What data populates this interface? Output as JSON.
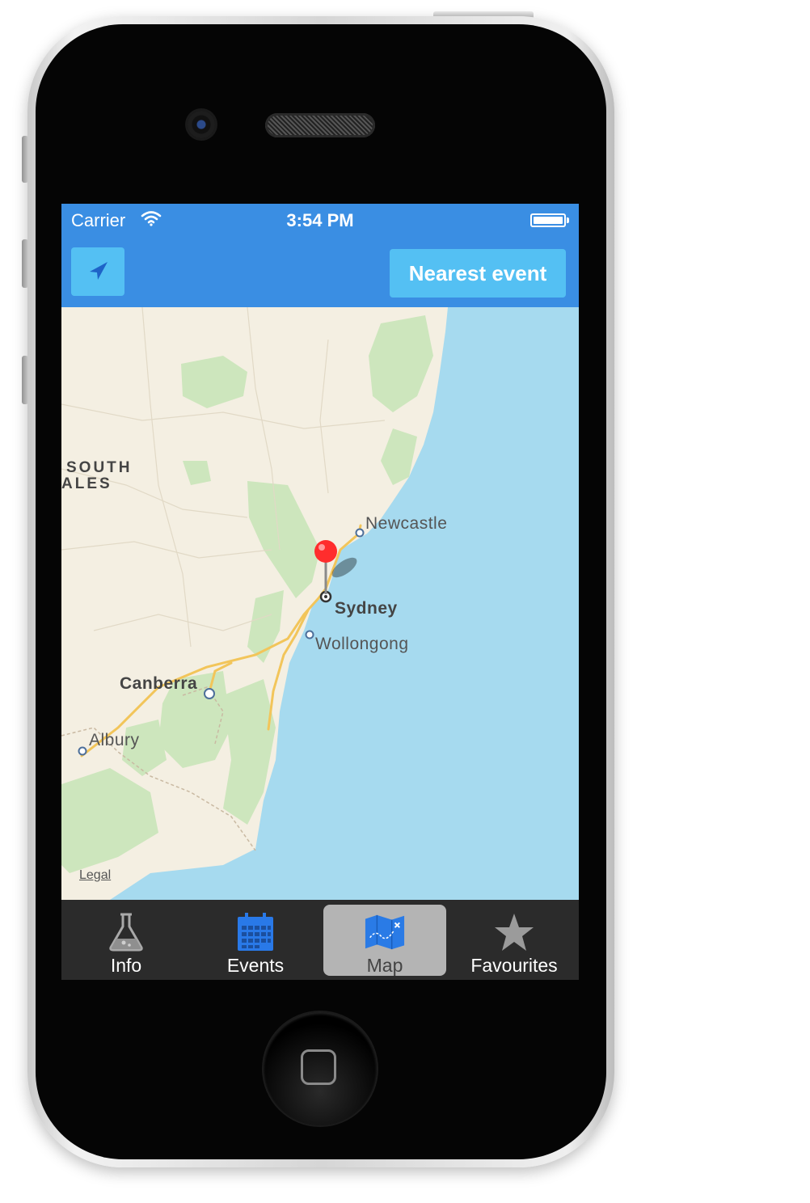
{
  "status_bar": {
    "carrier": "Carrier",
    "time": "3:54 PM"
  },
  "nav_bar": {
    "locate_icon": "location-arrow-icon",
    "nearest_button_label": "Nearest event"
  },
  "map": {
    "region_label_line1": "SOUTH",
    "region_label_line2": "ALES",
    "cities": [
      {
        "name": "Newcastle"
      },
      {
        "name": "Sydney"
      },
      {
        "name": "Wollongong"
      },
      {
        "name": "Canberra"
      },
      {
        "name": "Albury"
      }
    ],
    "legal_link": "Legal",
    "pin_color": "#ff2d2d",
    "water_color": "#a6daef",
    "land_color": "#f4efe2",
    "park_color": "#cde6bd"
  },
  "tab_bar": {
    "selected": "Map",
    "tabs": [
      {
        "label": "Info",
        "icon": "flask-icon"
      },
      {
        "label": "Events",
        "icon": "calendar-icon"
      },
      {
        "label": "Map",
        "icon": "map-icon"
      },
      {
        "label": "Favourites",
        "icon": "star-icon"
      }
    ]
  },
  "colors": {
    "accent": "#3a8ee3",
    "button": "#54c0f3",
    "tab_bar": "#2b2b2b"
  }
}
